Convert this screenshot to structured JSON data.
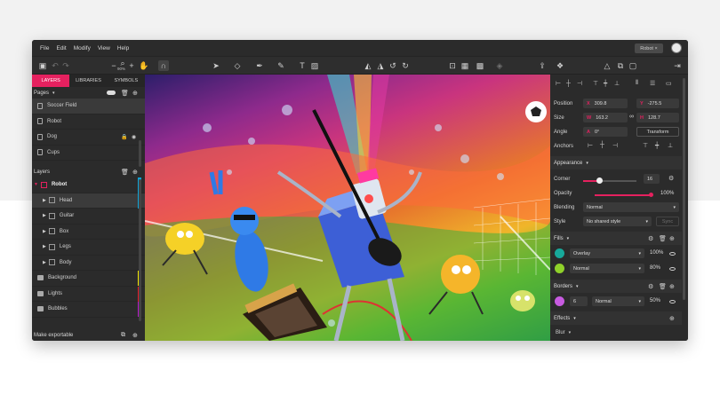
{
  "menu": {
    "items": [
      "File",
      "Edit",
      "Modify",
      "View",
      "Help"
    ]
  },
  "document_tab": "Robot",
  "toolbar": {
    "zoom": "90%"
  },
  "left_panel": {
    "tabs": [
      {
        "label": "LAYERS"
      },
      {
        "label": "LIBRARIES"
      },
      {
        "label": "SYMBOLS"
      }
    ],
    "pages_label": "Pages",
    "pages": [
      {
        "name": "Soccer Field"
      },
      {
        "name": "Robot"
      },
      {
        "name": "Dog"
      },
      {
        "name": "Cups"
      }
    ],
    "layers_label": "Layers",
    "layers": [
      {
        "name": "Robot"
      },
      {
        "name": "Head"
      },
      {
        "name": "Guitar"
      },
      {
        "name": "Box"
      },
      {
        "name": "Legs"
      },
      {
        "name": "Body"
      },
      {
        "name": "Background"
      },
      {
        "name": "Lights"
      },
      {
        "name": "Bubbles"
      }
    ],
    "layer_colors": {
      "head": "#0fa3d6",
      "background": "#f2e600",
      "lights": "#e51b2a",
      "bubbles": "#b617c9",
      "robot": "#e5215f"
    },
    "footer": "Make exportable"
  },
  "inspector": {
    "position": {
      "label": "Position",
      "x": "309.8",
      "y": "-275.5"
    },
    "size": {
      "label": "Size",
      "w": "163.2",
      "h": "128.7"
    },
    "angle": {
      "label": "Angle",
      "value": "0°",
      "transform": "Transform"
    },
    "anchors_label": "Anchors",
    "appearance": {
      "label": "Appearance",
      "corner_label": "Corner",
      "corner_value": "16",
      "opacity_label": "Opacity",
      "opacity_value": "100%",
      "opacity": 1.0,
      "blending_label": "Blending",
      "blending_value": "Normal",
      "style_label": "Style",
      "style_value": "No shared style",
      "sync": "Sync"
    },
    "fills": {
      "label": "Fills",
      "items": [
        {
          "mode": "Overlay",
          "opacity": "100%",
          "color": "#17a89a"
        },
        {
          "mode": "Normal",
          "opacity": "80%",
          "color": "#8fd12a"
        }
      ]
    },
    "borders": {
      "label": "Borders",
      "items": [
        {
          "width": "6",
          "mode": "Normal",
          "opacity": "50%",
          "color": "#c75be0"
        }
      ]
    },
    "effects": {
      "label": "Effects"
    },
    "blur": {
      "label": "Blur"
    }
  },
  "colors": {
    "accent": "#e5215f"
  }
}
